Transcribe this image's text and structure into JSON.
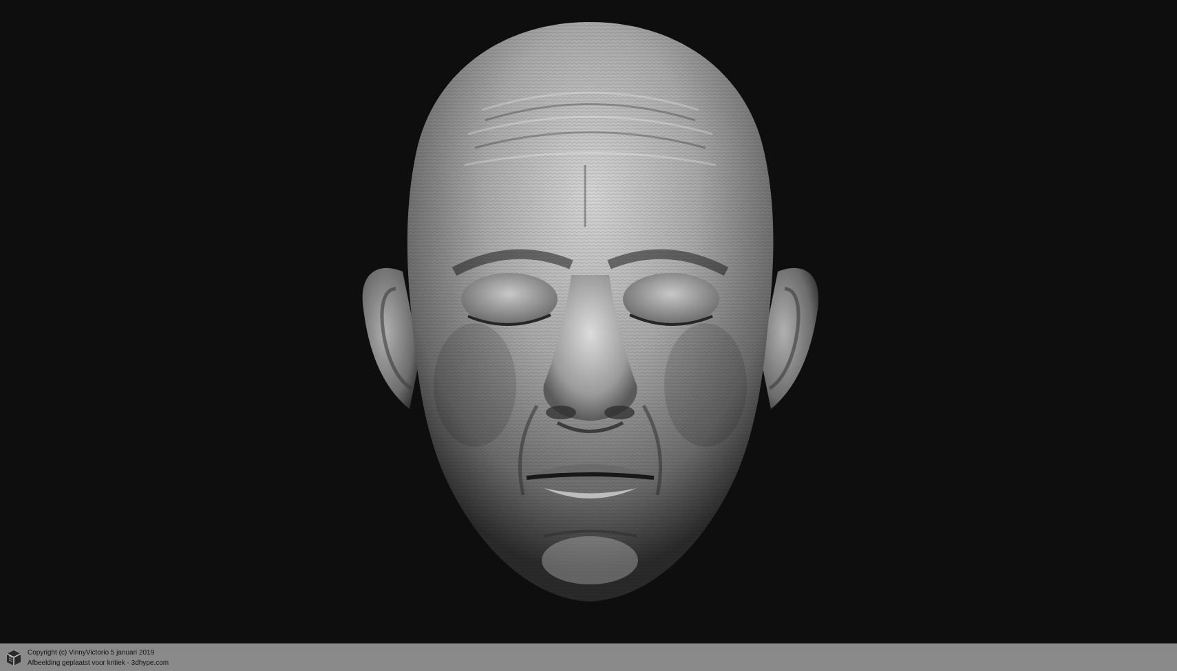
{
  "image": {
    "subject": "sculpted-head-render",
    "background_color": "#0e0e0e",
    "sculpt_color": "#9e9e9e"
  },
  "footer": {
    "copyright": "Copyright (c) VinnyVictorio 5 januari 2019",
    "posted": "Afbeelding geplaatst voor kritiek - 3dhype.com",
    "bar_color": "#8a8a8a",
    "logo": "3dhype-cube-logo"
  }
}
